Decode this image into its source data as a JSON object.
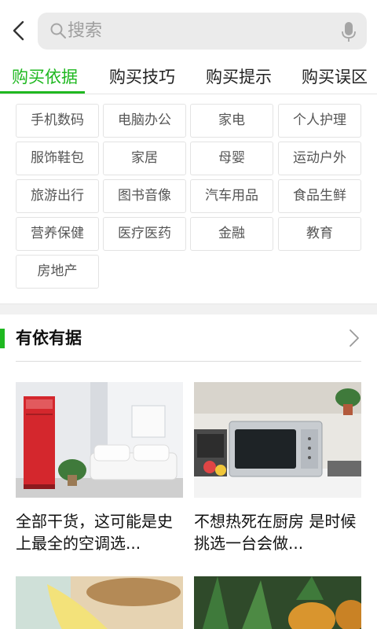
{
  "search": {
    "placeholder": "搜索"
  },
  "tabs": [
    {
      "label": "购买依据",
      "active": true
    },
    {
      "label": "购买技巧",
      "active": false
    },
    {
      "label": "购买提示",
      "active": false
    },
    {
      "label": "购买误区",
      "active": false
    }
  ],
  "categories": [
    "手机数码",
    "电脑办公",
    "家电",
    "个人护理",
    "服饰鞋包",
    "家居",
    "母婴",
    "运动户外",
    "旅游出行",
    "图书音像",
    "汽车用品",
    "食品生鲜",
    "营养保健",
    "医疗医药",
    "金融",
    "教育",
    "房地产"
  ],
  "section": {
    "title": "有依有据"
  },
  "articles": [
    {
      "title": "全部干货，这可能是史上最全的空调选..."
    },
    {
      "title": "不想热死在厨房 是时候挑选一台会做..."
    }
  ],
  "colors": {
    "accent": "#1fb820",
    "search_bg": "#ebebeb"
  }
}
